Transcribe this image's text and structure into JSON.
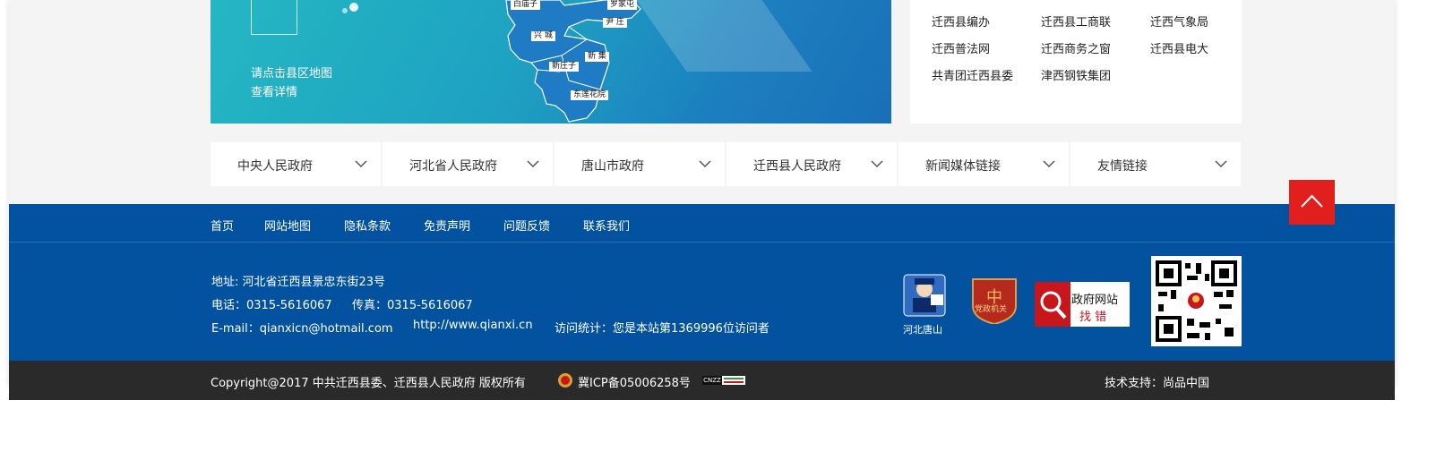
{
  "map": {
    "hint_line1": "请点击县区地图",
    "hint_line2": "查看详情",
    "towns": [
      "白庙子",
      "罗家屯",
      "尹 庄",
      "兴 城",
      "新 集",
      "新庄子",
      "东莲花院"
    ]
  },
  "links": {
    "items": [
      "迁西县编办",
      "迁西县工商联",
      "迁西气象局",
      "迁西普法网",
      "迁西商务之窗",
      "迁西县电大",
      "共青团迁西县委",
      "津西钢铁集团"
    ]
  },
  "dropdowns": [
    "中央人民政府",
    "河北省人民政府",
    "唐山市政府",
    "迁西县人民政府",
    "新闻媒体链接",
    "友情链接"
  ],
  "footer_nav": [
    "首页",
    "网站地图",
    "隐私条款",
    "免责声明",
    "问题反馈",
    "联系我们"
  ],
  "footer_info": {
    "address": "地址: 河北省迁西县景忠东街23号",
    "phone": "电话：0315-5616067",
    "fax": "传真：0315-5616067",
    "email": "E-mail：qianxicn@hotmail.com",
    "website": "http://www.qianxi.cn",
    "visits": "访问统计：您是本站第1369996位访问者"
  },
  "badges": {
    "hebei_tangshan": "河北唐山",
    "party_label": "党政机关",
    "gov_error_line1": "政府网站",
    "gov_error_line2": "找 错"
  },
  "footer_bottom": {
    "copyright": "Copyright@2017 中共迁西县委、迁西县人民政府 版权所有",
    "icp": "冀ICP备05006258号",
    "cnzz": "CNZZ",
    "support": "技术支持：尚品中国"
  },
  "colors": {
    "footer_blue": "#03529f",
    "footer_dark": "#2a2a2a",
    "back_top_red": "#e1201d",
    "map_teal": "#25b7c3"
  }
}
